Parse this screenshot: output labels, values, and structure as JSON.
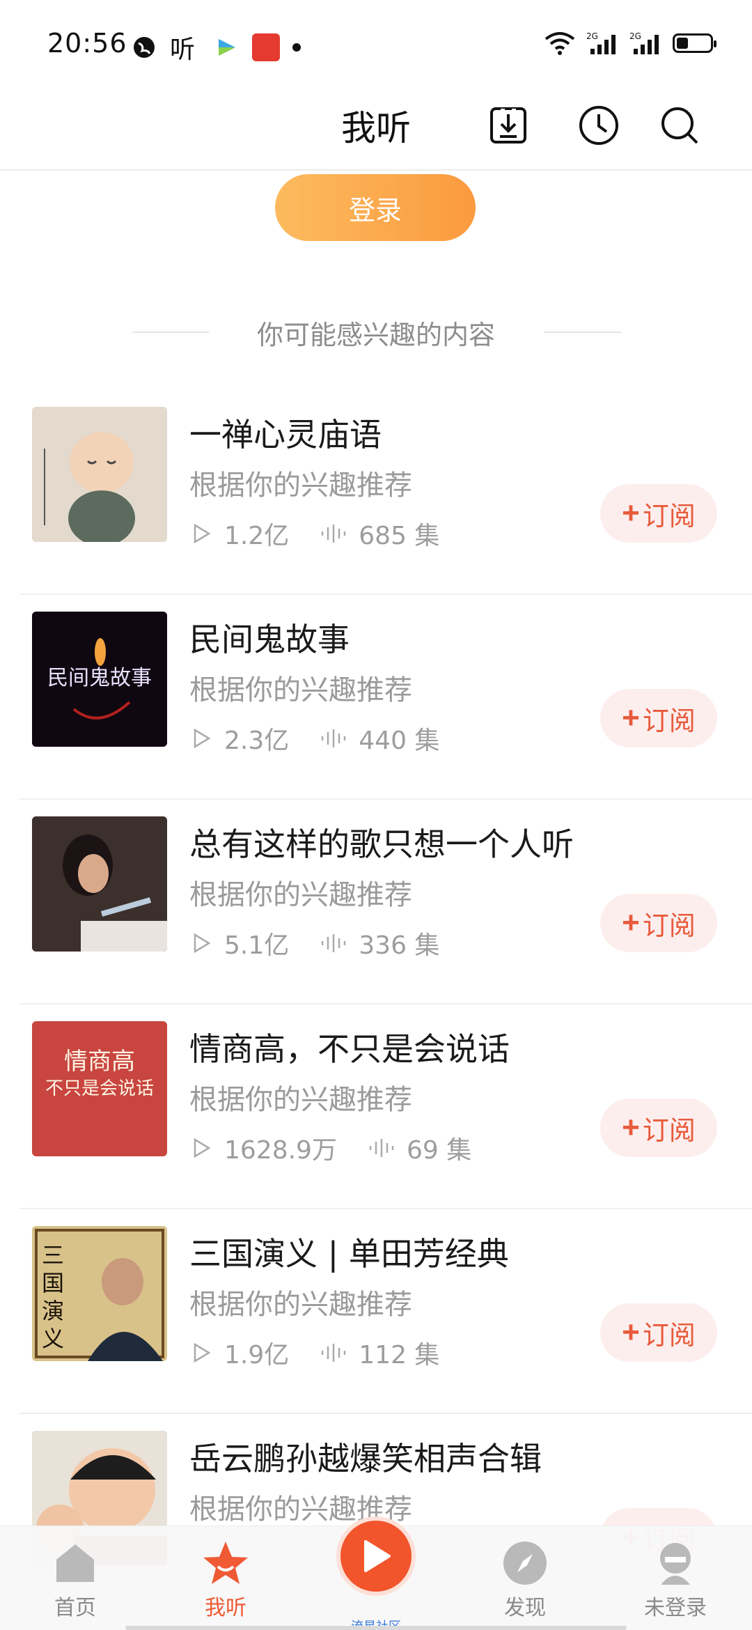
{
  "status_bar": {
    "time": "20:56",
    "app_icon_text": "听",
    "network_1": "2G",
    "network_2": "2G"
  },
  "header": {
    "title": "我听",
    "icons": [
      "download-icon",
      "history-clock-icon",
      "search-icon"
    ]
  },
  "login_label": "登录",
  "section_title": "你可能感兴趣的内容",
  "items": [
    {
      "title": "一禅心灵庙语",
      "subtitle": "根据你的兴趣推荐",
      "plays": "1.2亿",
      "episodes": "685 集",
      "subscribe": "订阅",
      "cover_color": "#d9cdbf"
    },
    {
      "title": "民间鬼故事",
      "subtitle": "根据你的兴趣推荐",
      "plays": "2.3亿",
      "episodes": "440 集",
      "subscribe": "订阅",
      "cover_color": "#120a12",
      "cover_text": "民间鬼故事"
    },
    {
      "title": "总有这样的歌只想一个人听",
      "subtitle": "根据你的兴趣推荐",
      "plays": "5.1亿",
      "episodes": "336 集",
      "subscribe": "订阅",
      "cover_color": "#4a3a36"
    },
    {
      "title": "情商高，不只是会说话",
      "subtitle": "根据你的兴趣推荐",
      "plays": "1628.9万",
      "episodes": "69 集",
      "subscribe": "订阅",
      "cover_color": "#c8463f",
      "cover_text": "情商高",
      "cover_text2": "不只是会说话"
    },
    {
      "title": "三国演义 | 单田芳经典",
      "subtitle": "根据你的兴趣推荐",
      "plays": "1.9亿",
      "episodes": "112 集",
      "subscribe": "订阅",
      "cover_color": "#d8c28a",
      "cover_text": "三国演义"
    },
    {
      "title": "岳云鹏孙越爆笑相声合辑",
      "subtitle": "根据你的兴趣推荐",
      "plays": "",
      "episodes": "",
      "subscribe": "订阅",
      "cover_color": "#2a6fc4"
    }
  ],
  "bottom_nav": {
    "home": "首页",
    "mine": "我听",
    "play_caption": "流星社区",
    "discover": "发现",
    "profile": "未登录"
  },
  "colors": {
    "accent": "#ef5a35",
    "login_gradient_start": "#fcbb5e",
    "login_gradient_end": "#fb9a3f",
    "subscribe_bg": "#fdeeee"
  }
}
